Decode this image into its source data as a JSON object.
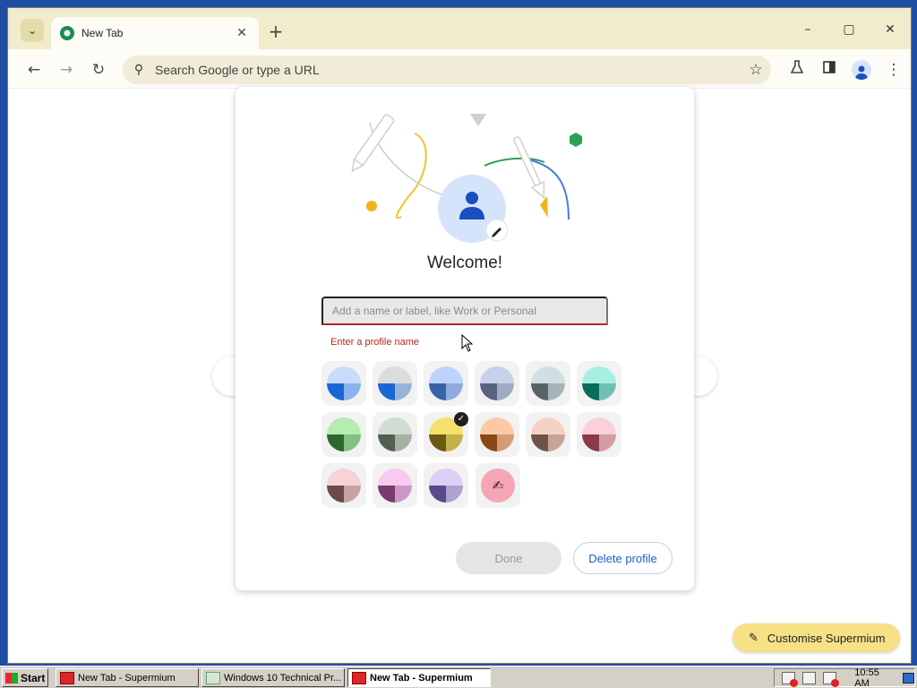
{
  "browser": {
    "tab_title": "New Tab",
    "tab_close_icon": "close-icon",
    "new_tab_label": "+",
    "omnibox_placeholder": "Search Google or type a URL"
  },
  "dialog": {
    "title": "Welcome!",
    "name_field": {
      "placeholder": "Add a name or label, like Work or Personal",
      "value": ""
    },
    "error_text": "Enter a profile name",
    "color_swatches": [
      {
        "name": "light-blue",
        "light": "#c8dcfa",
        "dark": "#1a66d6",
        "selected": false
      },
      {
        "name": "grey",
        "light": "#dcdcdc",
        "dark": "#1a66d6",
        "selected": false
      },
      {
        "name": "blue",
        "light": "#bdd3fb",
        "dark": "#3a62a8",
        "selected": false
      },
      {
        "name": "slate",
        "light": "#c7d2ea",
        "dark": "#56627e",
        "selected": false
      },
      {
        "name": "blue-grey",
        "light": "#d2dfe2",
        "dark": "#566467",
        "selected": false
      },
      {
        "name": "teal",
        "light": "#a8efe2",
        "dark": "#0a6a5c",
        "selected": false
      },
      {
        "name": "green",
        "light": "#b6ecb0",
        "dark": "#2c6a2c",
        "selected": false
      },
      {
        "name": "sage",
        "light": "#d1dcd2",
        "dark": "#526052",
        "selected": false
      },
      {
        "name": "yellow",
        "light": "#f5e06a",
        "dark": "#6b5a10",
        "selected": true
      },
      {
        "name": "orange",
        "light": "#fcc9a6",
        "dark": "#8c4716",
        "selected": false
      },
      {
        "name": "peach",
        "light": "#f6d2c4",
        "dark": "#6c5248",
        "selected": false
      },
      {
        "name": "rose",
        "light": "#fbd0d8",
        "dark": "#8a3a4c",
        "selected": false
      },
      {
        "name": "pink",
        "light": "#f7d2d6",
        "dark": "#6a4a4c",
        "selected": false
      },
      {
        "name": "magenta",
        "light": "#f8caf0",
        "dark": "#7a3c6e",
        "selected": false
      },
      {
        "name": "purple",
        "light": "#dcd0f6",
        "dark": "#5a4a8a",
        "selected": false
      }
    ],
    "custom_color_icon": "eyedropper-icon",
    "done_label": "Done",
    "delete_label": "Delete profile"
  },
  "customise_button": "Customise Supermium",
  "taskbar": {
    "start_label": "Start",
    "items": [
      {
        "label": "New Tab - Supermium",
        "active": false
      },
      {
        "label": "Windows 10 Technical Pr...",
        "active": false
      },
      {
        "label": "New Tab - Supermium",
        "active": true
      }
    ],
    "clock": "10:55 AM"
  }
}
